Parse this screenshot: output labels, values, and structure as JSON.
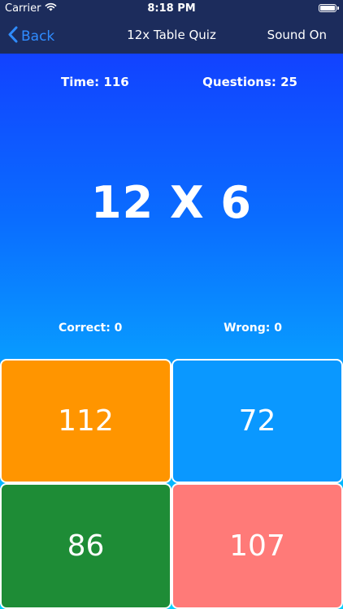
{
  "status_bar": {
    "carrier": "Carrier",
    "time": "8:18 PM"
  },
  "nav": {
    "back_label": "Back",
    "title": "12x Table Quiz",
    "sound_label": "Sound On"
  },
  "quiz": {
    "time_label": "Time: 116",
    "questions_label": "Questions: 25",
    "question": "12 X 6",
    "correct_label": "Correct: 0",
    "wrong_label": "Wrong: 0"
  },
  "answers": [
    {
      "label": "112",
      "color": "#ff9500"
    },
    {
      "label": "72",
      "color": "#0a98ff"
    },
    {
      "label": "86",
      "color": "#1e8c36"
    },
    {
      "label": "107",
      "color": "#ff7a78"
    }
  ],
  "colors": {
    "nav_background": "#1c2c5c",
    "back_tint": "#2f8cff"
  }
}
